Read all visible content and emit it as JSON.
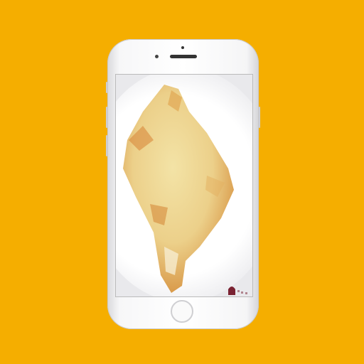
{
  "background_color": "#f5ae00",
  "icons": [
    "phone-frame",
    "food-photo",
    "watermark-logo"
  ]
}
